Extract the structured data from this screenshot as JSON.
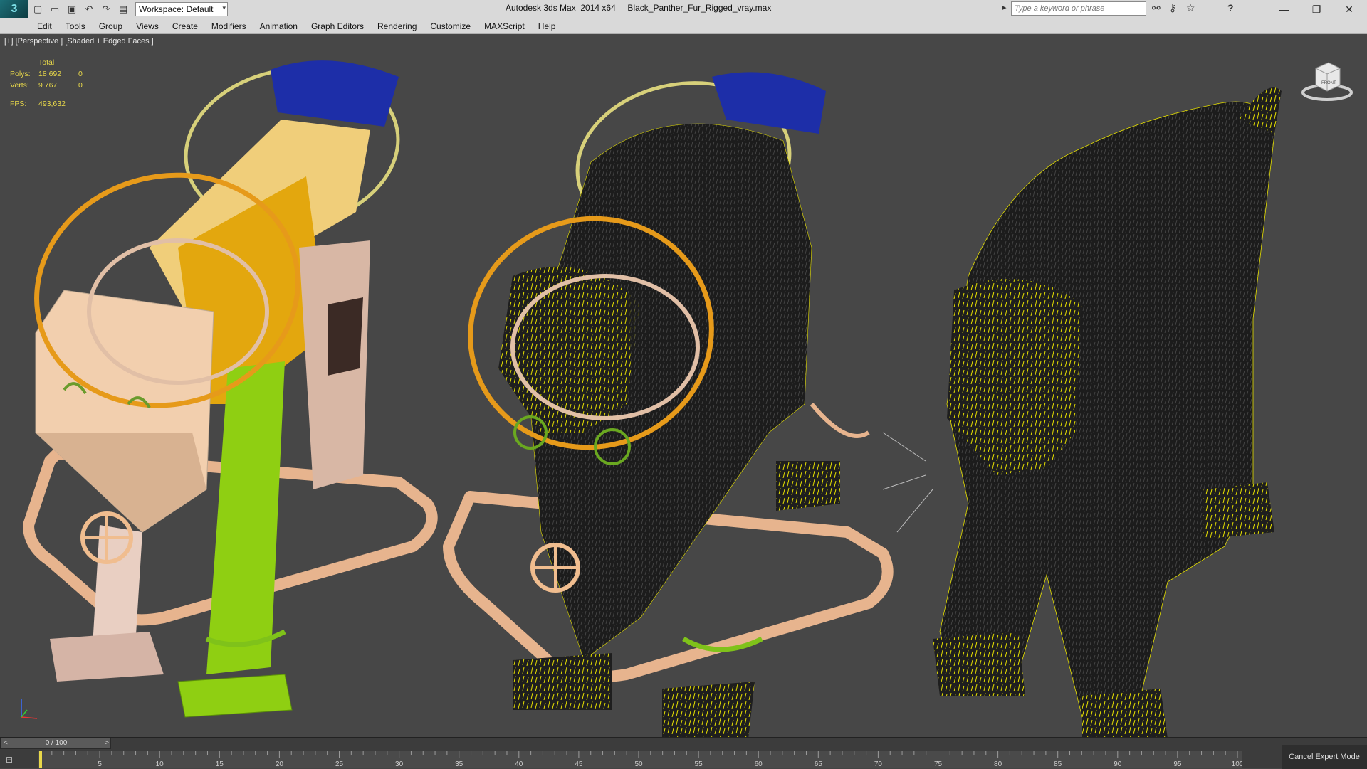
{
  "app": {
    "title": "Autodesk 3ds Max  2014 x64     Black_Panther_Fur_Rigged_vray.max",
    "logo_glyph": "3",
    "workspace_label": "Workspace: Default",
    "search_placeholder": "Type a keyword or phrase"
  },
  "icons": {
    "new": "new-file-icon",
    "open": "open-file-icon",
    "save": "save-icon",
    "undo": "undo-icon",
    "redo": "redo-icon",
    "project": "project-folder-icon",
    "binoculars": "binoculars-icon",
    "key": "key-icon",
    "star": "star-icon",
    "help": "help-icon"
  },
  "glyphs": {
    "new": "▢",
    "open": "▭",
    "save": "▣",
    "undo": "↶",
    "redo": "↷",
    "project": "▤",
    "binoculars": "⚯",
    "key": "⚷",
    "star": "☆",
    "help": "?",
    "minimize": "—",
    "restore": "❐",
    "close": "✕",
    "search_arrow": "▸",
    "dropdown": "▾",
    "slider_left": "<",
    "slider_right": ">",
    "timeline_key": "⊟"
  },
  "menu": [
    "Edit",
    "Tools",
    "Group",
    "Views",
    "Create",
    "Modifiers",
    "Animation",
    "Graph Editors",
    "Rendering",
    "Customize",
    "MAXScript",
    "Help"
  ],
  "viewport": {
    "label": "[+] [Perspective ] [Shaded + Edged Faces ]",
    "stats": {
      "header": "Total",
      "polys_label": "Polys:",
      "polys_value": "18 692",
      "polys_sel": "0",
      "verts_label": "Verts:",
      "verts_value": "9 767",
      "verts_sel": "0",
      "fps_label": "FPS:",
      "fps_value": "493,632"
    },
    "viewcube_label": "FRONT"
  },
  "timeline": {
    "slider_value": "0 / 100",
    "ticks": [
      "5",
      "10",
      "15",
      "20",
      "25",
      "30",
      "35",
      "40",
      "45",
      "50",
      "55",
      "60",
      "65",
      "70",
      "75",
      "80",
      "85",
      "90",
      "95",
      "100"
    ],
    "cancel_expert": "Cancel Expert Mode"
  },
  "colors": {
    "viewport_bg": "#474747",
    "fur_yellow": "#e6e000",
    "rig_orange": "#e69a1a",
    "rig_pale_yellow": "#d7d07a",
    "rig_blue": "#1d2ea8",
    "rig_green": "#8fcf12",
    "skin_tan": "#f0c9a6"
  }
}
